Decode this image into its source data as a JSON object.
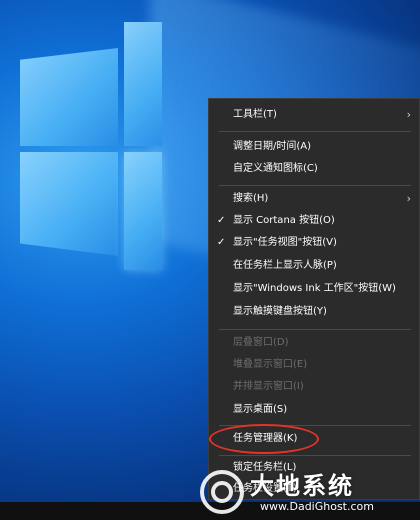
{
  "context_menu": {
    "items": [
      {
        "label": "工具栏(T)",
        "submenu": true
      },
      {
        "label": "调整日期/时间(A)"
      },
      {
        "label": "自定义通知图标(C)"
      },
      {
        "label": "搜索(H)",
        "submenu": true
      },
      {
        "label": "显示 Cortana 按钮(O)",
        "checked": true
      },
      {
        "label": "显示\"任务视图\"按钮(V)",
        "checked": true
      },
      {
        "label": "在任务栏上显示人脉(P)"
      },
      {
        "label": "显示\"Windows Ink 工作区\"按钮(W)"
      },
      {
        "label": "显示触摸键盘按钮(Y)"
      },
      {
        "label": "层叠窗口(D)",
        "disabled": true
      },
      {
        "label": "堆叠显示窗口(E)",
        "disabled": true
      },
      {
        "label": "并排显示窗口(I)",
        "disabled": true
      },
      {
        "label": "显示桌面(S)"
      },
      {
        "label": "任务管理器(K)",
        "highlighted": true
      },
      {
        "label": "锁定任务栏(L)"
      },
      {
        "label": "任务栏设置(T)"
      }
    ],
    "check_glyph": "✓",
    "submenu_glyph": "›"
  },
  "watermark": {
    "text": "大地系统",
    "url": "www.DadiGhost.com"
  },
  "colors": {
    "menu_bg": "#2b2b2b",
    "menu_text": "#ffffff",
    "disabled_text": "#6e6e6e",
    "highlight_ring": "#e0342a",
    "desktop_blue": "#0f6fd6"
  }
}
